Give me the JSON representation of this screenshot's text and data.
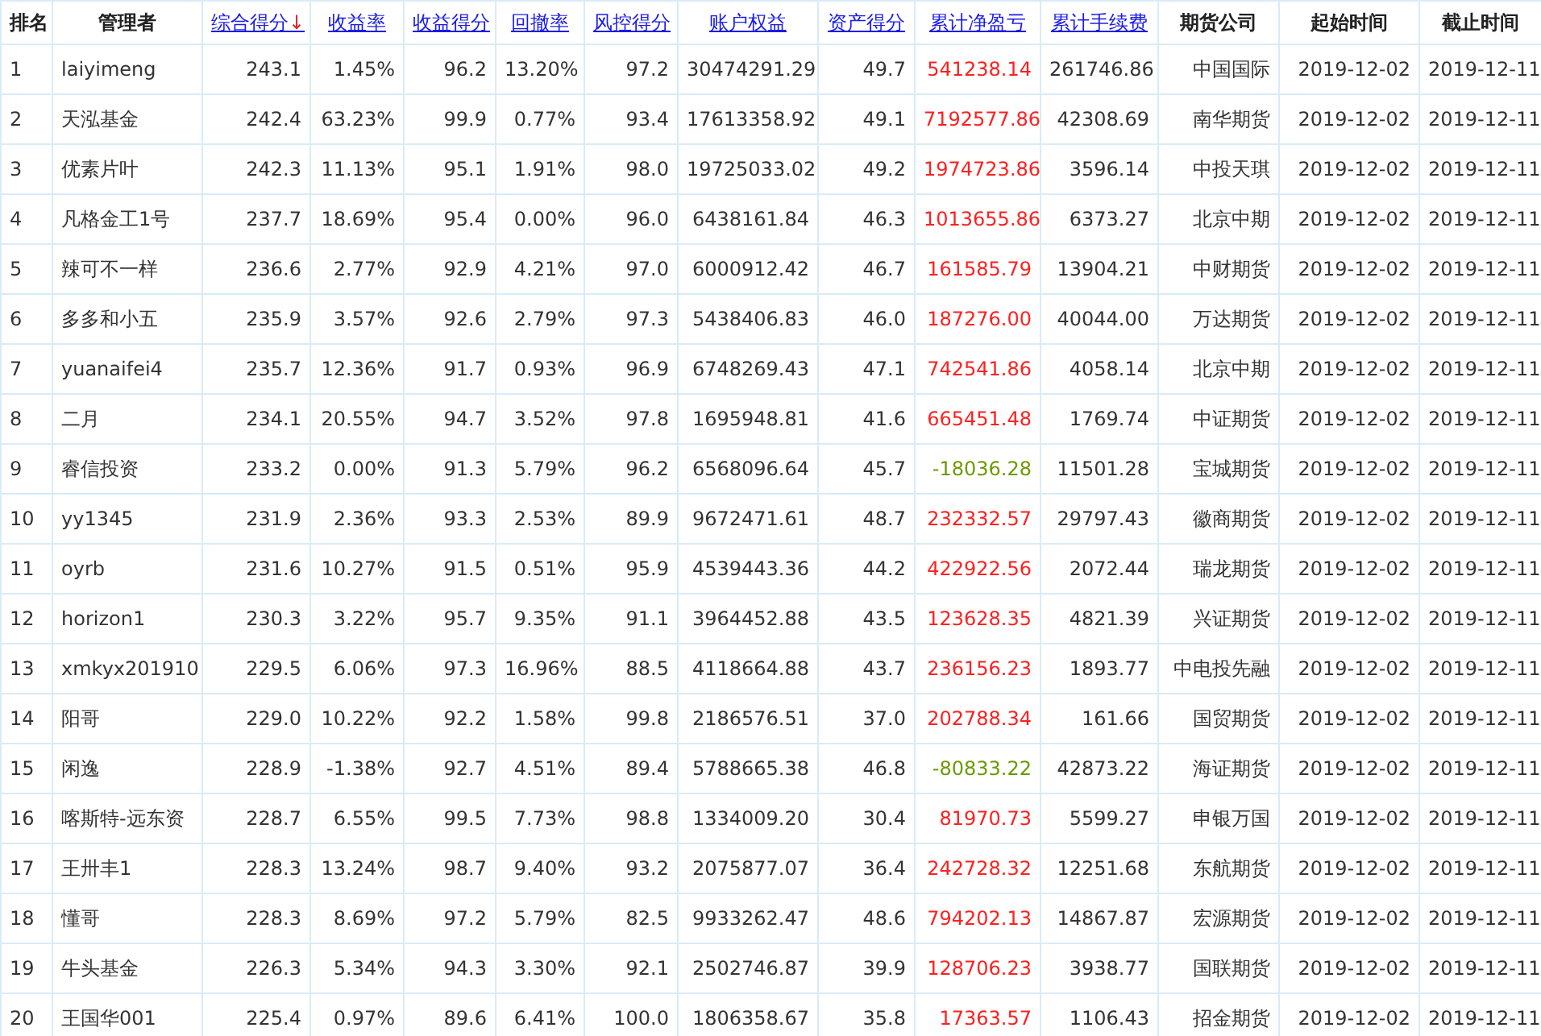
{
  "columns": [
    {
      "label": "排名",
      "link": false
    },
    {
      "label": "管理者",
      "link": false
    },
    {
      "label": "综合得分",
      "link": true,
      "sort_arrow": "↓"
    },
    {
      "label": "收益率",
      "link": true
    },
    {
      "label": "收益得分",
      "link": true
    },
    {
      "label": "回撤率",
      "link": true
    },
    {
      "label": "风控得分",
      "link": true
    },
    {
      "label": "账户权益",
      "link": true
    },
    {
      "label": "资产得分",
      "link": true
    },
    {
      "label": "累计净盈亏",
      "link": true
    },
    {
      "label": "累计手续费",
      "link": true
    },
    {
      "label": "期货公司",
      "link": false
    },
    {
      "label": "起始时间",
      "link": false
    },
    {
      "label": "截止时间",
      "link": false
    }
  ],
  "rows": [
    {
      "cells": [
        "1",
        "laiyimeng",
        "243.1",
        "1.45%",
        "96.2",
        "13.20%",
        "97.2",
        "30474291.29",
        "49.7",
        "541238.14",
        "261746.86",
        "中国国际",
        "2019-12-02",
        "2019-12-11"
      ],
      "color": "#ff2020"
    },
    {
      "cells": [
        "2",
        "天泓基金",
        "242.4",
        "63.23%",
        "99.9",
        "0.77%",
        "93.4",
        "17613358.92",
        "49.1",
        "7192577.86",
        "42308.69",
        "南华期货",
        "2019-12-02",
        "2019-12-11"
      ],
      "color": "#ff2020"
    },
    {
      "cells": [
        "3",
        "优素片叶",
        "242.3",
        "11.13%",
        "95.1",
        "1.91%",
        "98.0",
        "19725033.02",
        "49.2",
        "1974723.86",
        "3596.14",
        "中投天琪",
        "2019-12-02",
        "2019-12-11"
      ],
      "color": "#ff2020"
    },
    {
      "cells": [
        "4",
        "凡格金工1号",
        "237.7",
        "18.69%",
        "95.4",
        "0.00%",
        "96.0",
        "6438161.84",
        "46.3",
        "1013655.86",
        "6373.27",
        "北京中期",
        "2019-12-02",
        "2019-12-11"
      ],
      "color": "#ff2020"
    },
    {
      "cells": [
        "5",
        "辣可不一样",
        "236.6",
        "2.77%",
        "92.9",
        "4.21%",
        "97.0",
        "6000912.42",
        "46.7",
        "161585.79",
        "13904.21",
        "中财期货",
        "2019-12-02",
        "2019-12-11"
      ],
      "color": "#ff2020"
    },
    {
      "cells": [
        "6",
        "多多和小五",
        "235.9",
        "3.57%",
        "92.6",
        "2.79%",
        "97.3",
        "5438406.83",
        "46.0",
        "187276.00",
        "40044.00",
        "万达期货",
        "2019-12-02",
        "2019-12-11"
      ],
      "color": "#ff2020"
    },
    {
      "cells": [
        "7",
        "yuanaifei4",
        "235.7",
        "12.36%",
        "91.7",
        "0.93%",
        "96.9",
        "6748269.43",
        "47.1",
        "742541.86",
        "4058.14",
        "北京中期",
        "2019-12-02",
        "2019-12-11"
      ],
      "color": "#ff2020"
    },
    {
      "cells": [
        "8",
        "二月",
        "234.1",
        "20.55%",
        "94.7",
        "3.52%",
        "97.8",
        "1695948.81",
        "41.6",
        "665451.48",
        "1769.74",
        "中证期货",
        "2019-12-02",
        "2019-12-11"
      ],
      "color": "#ff2020"
    },
    {
      "cells": [
        "9",
        "睿信投资",
        "233.2",
        "0.00%",
        "91.3",
        "5.79%",
        "96.2",
        "6568096.64",
        "45.7",
        "-18036.28",
        "11501.28",
        "宝城期货",
        "2019-12-02",
        "2019-12-11"
      ],
      "color": "#6b9a00"
    },
    {
      "cells": [
        "10",
        "yy1345",
        "231.9",
        "2.36%",
        "93.3",
        "2.53%",
        "89.9",
        "9672471.61",
        "48.7",
        "232332.57",
        "29797.43",
        "徽商期货",
        "2019-12-02",
        "2019-12-11"
      ],
      "color": "#ff2020"
    },
    {
      "cells": [
        "11",
        "oyrb",
        "231.6",
        "10.27%",
        "91.5",
        "0.51%",
        "95.9",
        "4539443.36",
        "44.2",
        "422922.56",
        "2072.44",
        "瑞龙期货",
        "2019-12-02",
        "2019-12-11"
      ],
      "color": "#ff2020"
    },
    {
      "cells": [
        "12",
        "horizon1",
        "230.3",
        "3.22%",
        "95.7",
        "9.35%",
        "91.1",
        "3964452.88",
        "43.5",
        "123628.35",
        "4821.39",
        "兴证期货",
        "2019-12-02",
        "2019-12-11"
      ],
      "color": "#ff2020"
    },
    {
      "cells": [
        "13",
        "xmkyx201910",
        "229.5",
        "6.06%",
        "97.3",
        "16.96%",
        "88.5",
        "4118664.88",
        "43.7",
        "236156.23",
        "1893.77",
        "中电投先融",
        "2019-12-02",
        "2019-12-11"
      ],
      "color": "#ff2020"
    },
    {
      "cells": [
        "14",
        "阳哥",
        "229.0",
        "10.22%",
        "92.2",
        "1.58%",
        "99.8",
        "2186576.51",
        "37.0",
        "202788.34",
        "161.66",
        "国贸期货",
        "2019-12-02",
        "2019-12-11"
      ],
      "color": "#ff2020"
    },
    {
      "cells": [
        "15",
        "闲逸",
        "228.9",
        "-1.38%",
        "92.7",
        "4.51%",
        "89.4",
        "5788665.38",
        "46.8",
        "-80833.22",
        "42873.22",
        "海证期货",
        "2019-12-02",
        "2019-12-11"
      ],
      "color": "#6b9a00"
    },
    {
      "cells": [
        "16",
        "喀斯特-远东资",
        "228.7",
        "6.55%",
        "99.5",
        "7.73%",
        "98.8",
        "1334009.20",
        "30.4",
        "81970.73",
        "5599.27",
        "申银万国",
        "2019-12-02",
        "2019-12-11"
      ],
      "color": "#ff2020"
    },
    {
      "cells": [
        "17",
        "王卅丰1",
        "228.3",
        "13.24%",
        "98.7",
        "9.40%",
        "93.2",
        "2075877.07",
        "36.4",
        "242728.32",
        "12251.68",
        "东航期货",
        "2019-12-02",
        "2019-12-11"
      ],
      "color": "#ff2020"
    },
    {
      "cells": [
        "18",
        "懂哥",
        "228.3",
        "8.69%",
        "97.2",
        "5.79%",
        "82.5",
        "9933262.47",
        "48.6",
        "794202.13",
        "14867.87",
        "宏源期货",
        "2019-12-02",
        "2019-12-11"
      ],
      "color": "#ff2020"
    },
    {
      "cells": [
        "19",
        "牛头基金",
        "226.3",
        "5.34%",
        "94.3",
        "3.30%",
        "92.1",
        "2502746.87",
        "39.9",
        "128706.23",
        "3938.77",
        "国联期货",
        "2019-12-02",
        "2019-12-11"
      ],
      "color": "#ff2020"
    },
    {
      "cells": [
        "20",
        "王国华001",
        "225.4",
        "0.97%",
        "89.6",
        "6.41%",
        "100.0",
        "1806358.67",
        "35.8",
        "17363.57",
        "1106.43",
        "招金期货",
        "2019-12-02",
        "2019-12-11"
      ],
      "color": "#ff2020"
    }
  ]
}
